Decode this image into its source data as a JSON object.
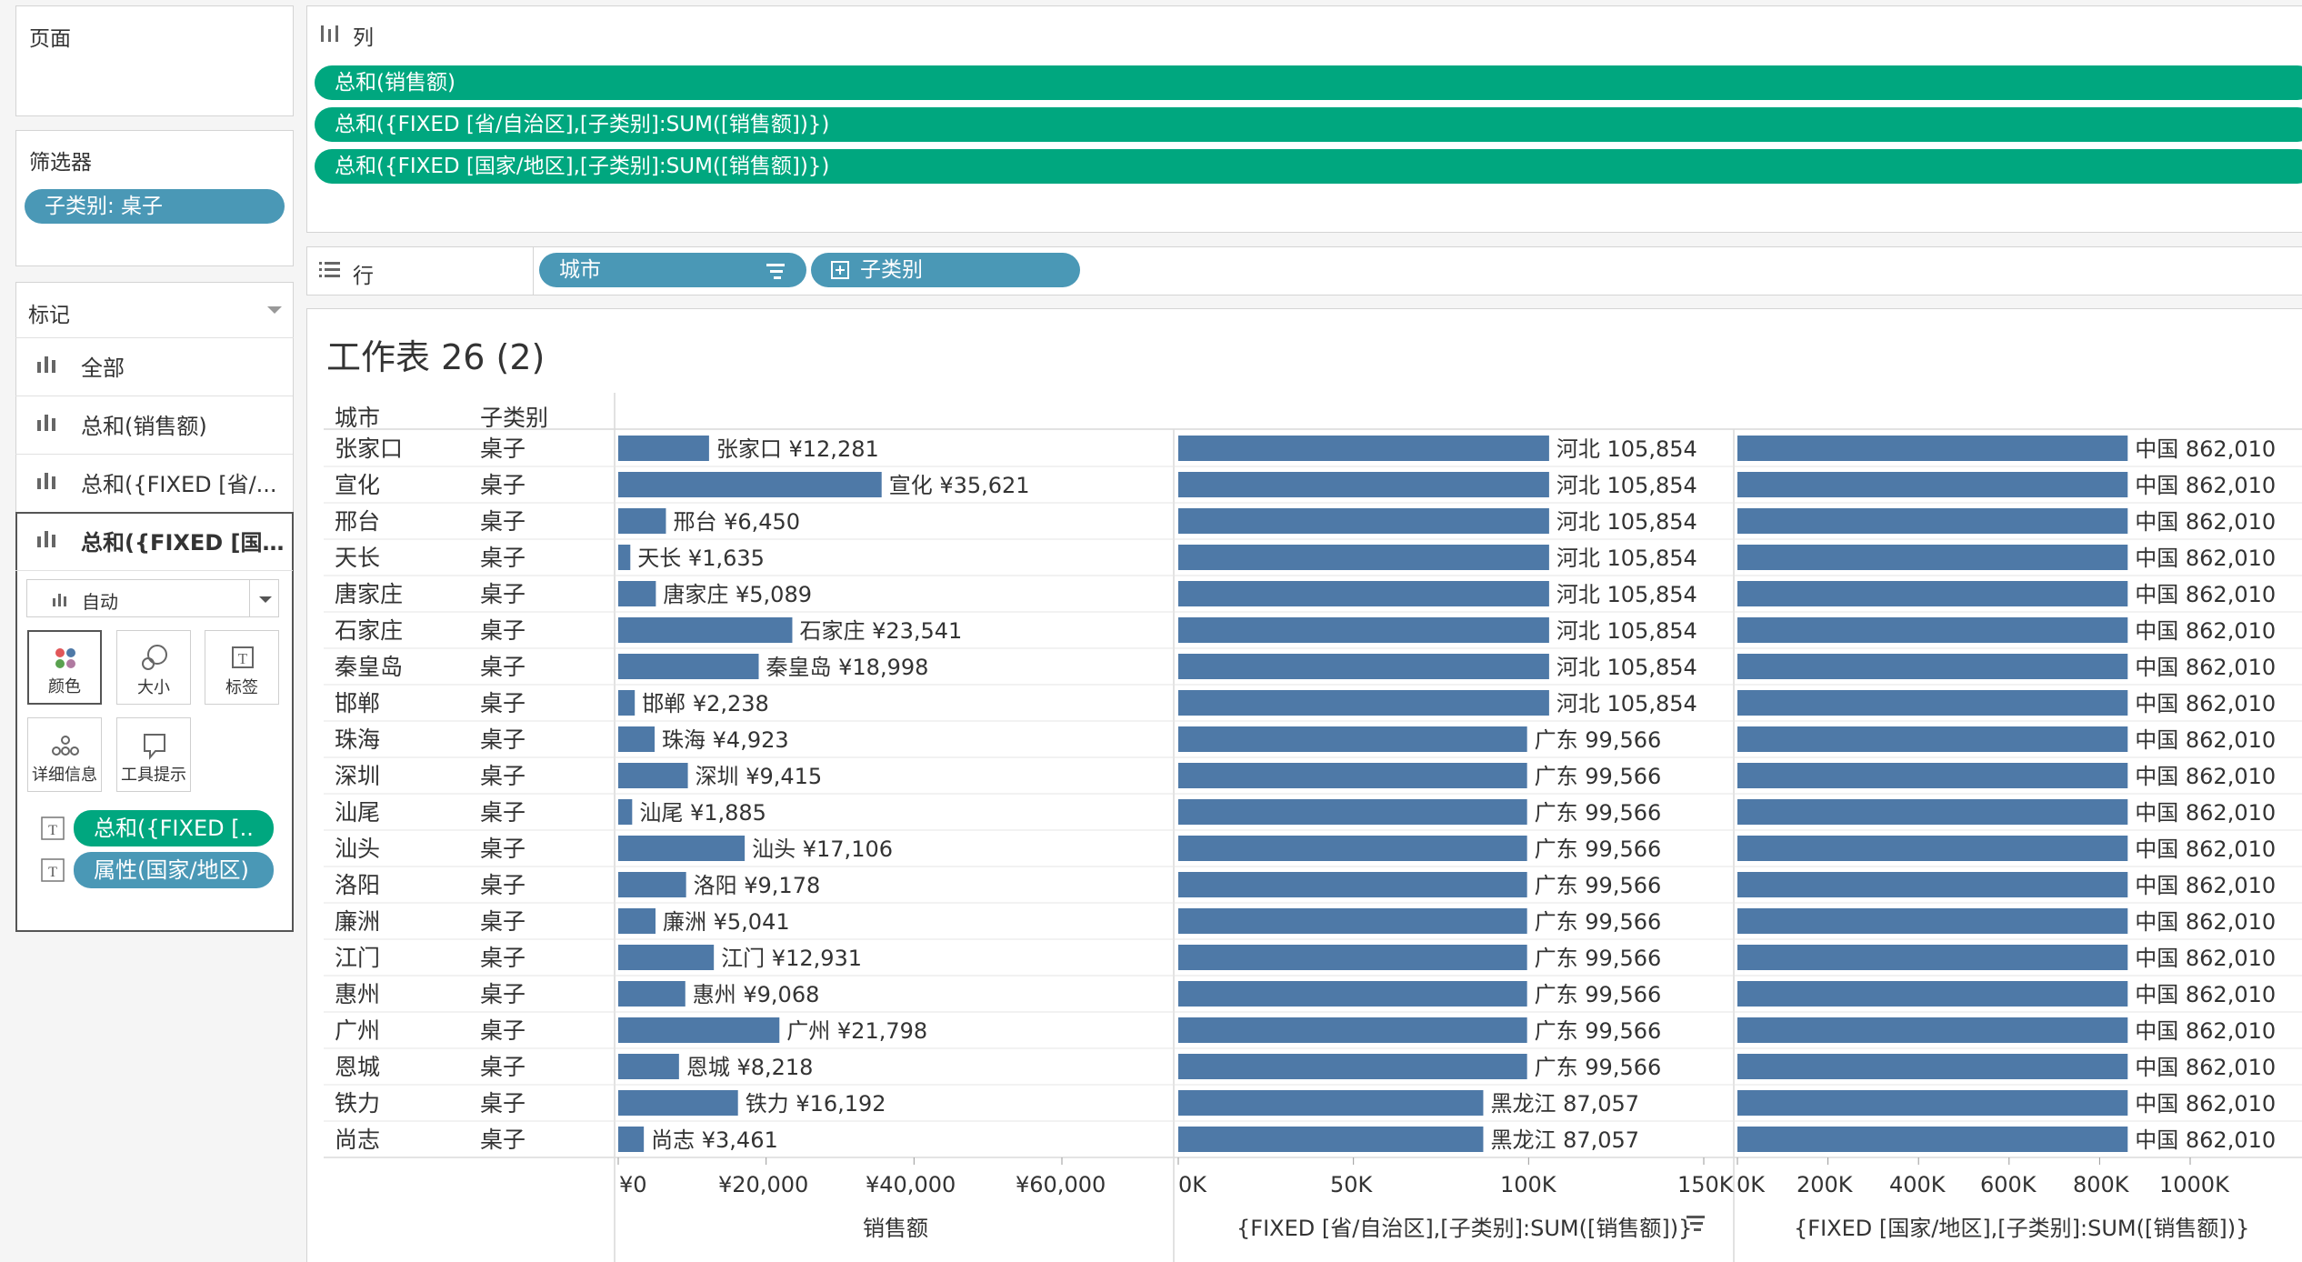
{
  "pages_shelf": {
    "title": "页面"
  },
  "filters_shelf": {
    "title": "筛选器",
    "pill": "子类别: 桌子"
  },
  "marks_card": {
    "title": "标记",
    "rows": [
      "全部",
      "总和(销售额)",
      "总和({FIXED [省/...",
      "总和({FIXED [国..."
    ],
    "mark_type": "自动",
    "buttons": {
      "color": "颜色",
      "size": "大小",
      "label": "标签",
      "detail": "详细信息",
      "tooltip": "工具提示"
    },
    "fields": [
      "总和({FIXED [..",
      "属性(国家/地区)"
    ]
  },
  "columns_shelf": {
    "title": "列",
    "pills": [
      "总和(销售额)",
      "总和({FIXED [省/自治区],[子类别]:SUM([销售额])})",
      "总和({FIXED [国家/地区],[子类别]:SUM([销售额])})"
    ]
  },
  "rows_shelf": {
    "title": "行",
    "pills": [
      "城市",
      "子类别"
    ]
  },
  "sheet": {
    "title": "工作表 26 (2)",
    "headers": {
      "city": "城市",
      "subcategory": "子类别"
    },
    "axis1": {
      "ticks": [
        "¥0",
        "¥20,000",
        "¥40,000",
        "¥60,000"
      ],
      "title": "销售额"
    },
    "axis2": {
      "ticks": [
        "0K",
        "50K",
        "100K",
        "150K"
      ],
      "title": "{FIXED [省/自治区],[子类别]:SUM([销售额])}"
    },
    "axis3": {
      "ticks": [
        "0K",
        "200K",
        "400K",
        "600K",
        "800K",
        "1000K"
      ],
      "title": "{FIXED [国家/地区],[子类别]:SUM([销售额])}"
    }
  },
  "colors": {
    "bar": "#4e79a7",
    "green_pill": "#00a77f",
    "blue_pill": "#4a98b6"
  },
  "chart_data": {
    "type": "bar",
    "orientation": "horizontal",
    "categories": [
      "张家口",
      "宣化",
      "邢台",
      "天长",
      "唐家庄",
      "石家庄",
      "秦皇岛",
      "邯郸",
      "珠海",
      "深圳",
      "汕尾",
      "汕头",
      "洛阳",
      "廉洲",
      "江门",
      "惠州",
      "广州",
      "恩城",
      "铁力",
      "尚志"
    ],
    "subcategory": "桌子",
    "series": [
      {
        "name": "销售额",
        "values": [
          12281,
          35621,
          6450,
          1635,
          5089,
          23541,
          18998,
          2238,
          4923,
          9415,
          1885,
          17106,
          9178,
          5041,
          12931,
          9068,
          21798,
          8218,
          16192,
          3461
        ],
        "labels": [
          "张家口 ¥12,281",
          "宣化 ¥35,621",
          "邢台 ¥6,450",
          "天长 ¥1,635",
          "唐家庄 ¥5,089",
          "石家庄 ¥23,541",
          "秦皇岛 ¥18,998",
          "邯郸 ¥2,238",
          "珠海 ¥4,923",
          "深圳 ¥9,415",
          "汕尾 ¥1,885",
          "汕头 ¥17,106",
          "洛阳 ¥9,178",
          "廉洲 ¥5,041",
          "江门 ¥12,931",
          "惠州 ¥9,068",
          "广州 ¥21,798",
          "恩城 ¥8,218",
          "铁力 ¥16,192",
          "尚志 ¥3,461"
        ],
        "xlim": [
          0,
          72000
        ]
      },
      {
        "name": "{FIXED [省/自治区],[子类别]:SUM([销售额])}",
        "values": [
          105854,
          105854,
          105854,
          105854,
          105854,
          105854,
          105854,
          105854,
          99566,
          99566,
          99566,
          99566,
          99566,
          99566,
          99566,
          99566,
          99566,
          99566,
          87057,
          87057
        ],
        "labels": [
          "河北 105,854",
          "河北 105,854",
          "河北 105,854",
          "河北 105,854",
          "河北 105,854",
          "河北 105,854",
          "河北 105,854",
          "河北 105,854",
          "广东 99,566",
          "广东 99,566",
          "广东 99,566",
          "广东 99,566",
          "广东 99,566",
          "广东 99,566",
          "广东 99,566",
          "广东 99,566",
          "广东 99,566",
          "广东 99,566",
          "黑龙江 87,057",
          "黑龙江 87,057"
        ],
        "xlim": [
          0,
          150000
        ]
      },
      {
        "name": "{FIXED [国家/地区],[子类别]:SUM([销售额])}",
        "values": [
          862010,
          862010,
          862010,
          862010,
          862010,
          862010,
          862010,
          862010,
          862010,
          862010,
          862010,
          862010,
          862010,
          862010,
          862010,
          862010,
          862010,
          862010,
          862010,
          862010
        ],
        "labels": [
          "中国 862,010",
          "中国 862,010",
          "中国 862,010",
          "中国 862,010",
          "中国 862,010",
          "中国 862,010",
          "中国 862,010",
          "中国 862,010",
          "中国 862,010",
          "中国 862,010",
          "中国 862,010",
          "中国 862,010",
          "中国 862,010",
          "中国 862,010",
          "中国 862,010",
          "中国 862,010",
          "中国 862,010",
          "中国 862,010",
          "中国 862,010",
          "中国 862,010"
        ],
        "xlim": [
          0,
          1200000
        ]
      }
    ]
  }
}
